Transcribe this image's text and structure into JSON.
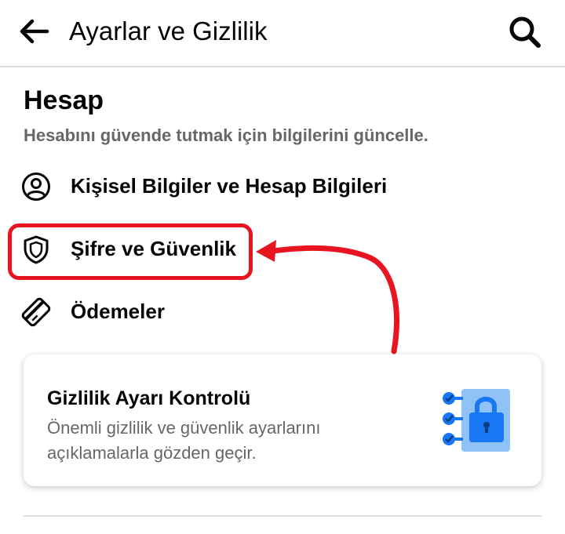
{
  "header": {
    "title": "Ayarlar ve Gizlilik",
    "back_icon": "arrow-left-icon",
    "search_icon": "search-icon"
  },
  "section": {
    "title": "Hesap",
    "subtitle": "Hesabını güvende tutmak için bilgilerini güncelle."
  },
  "menu": [
    {
      "label": "Kişisel Bilgiler ve Hesap Bilgileri",
      "icon": "user-circle-icon"
    },
    {
      "label": "Şifre ve Güvenlik",
      "icon": "shield-icon",
      "highlighted": true
    },
    {
      "label": "Ödemeler",
      "icon": "payment-card-icon"
    }
  ],
  "card": {
    "title": "Gizlilik Ayarı Kontrolü",
    "text": "Önemli gizlilik ve güvenlik ayarlarını açıklamalarla gözden geçir.",
    "illustration": "checklist-lock-icon"
  },
  "colors": {
    "highlight": "#e8141f",
    "secondary_text": "#65676b",
    "divider": "#dcdde0",
    "illustration_blue": "#1877f2",
    "illustration_light_blue": "#8fc3f7"
  }
}
